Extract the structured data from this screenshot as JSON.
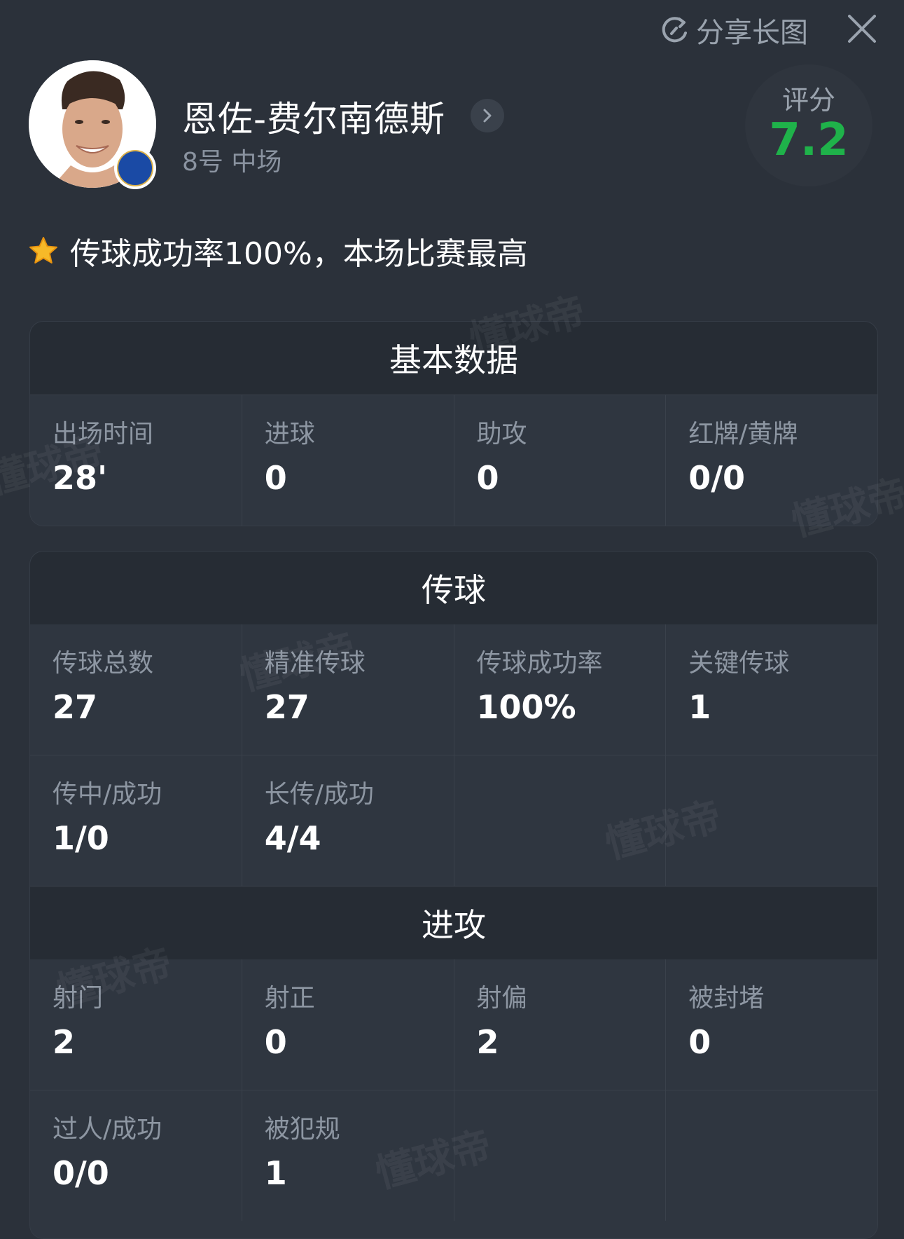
{
  "topbar": {
    "share_label": "分享长图"
  },
  "player": {
    "name": "恩佐-费尔南德斯",
    "number_position": "8号 中场",
    "rating_label": "评分",
    "rating_value": "7.2",
    "club_badge_text": "CHELSEA FOOTBALL CLUB"
  },
  "highlight": {
    "text": "传球成功率100%，本场比赛最高"
  },
  "watermark": "懂球帝",
  "basic": {
    "title": "基本数据",
    "rows": [
      [
        {
          "label": "出场时间",
          "value": "28'"
        },
        {
          "label": "进球",
          "value": "0"
        },
        {
          "label": "助攻",
          "value": "0"
        },
        {
          "label": "红牌/黄牌",
          "value": "0/0"
        }
      ]
    ]
  },
  "passing": {
    "title": "传球",
    "rows": [
      [
        {
          "label": "传球总数",
          "value": "27"
        },
        {
          "label": "精准传球",
          "value": "27"
        },
        {
          "label": "传球成功率",
          "value": "100%"
        },
        {
          "label": "关键传球",
          "value": "1"
        }
      ],
      [
        {
          "label": "传中/成功",
          "value": "1/0"
        },
        {
          "label": "长传/成功",
          "value": "4/4"
        },
        {
          "label": "",
          "value": ""
        },
        {
          "label": "",
          "value": ""
        }
      ]
    ]
  },
  "attack": {
    "title": "进攻",
    "rows": [
      [
        {
          "label": "射门",
          "value": "2"
        },
        {
          "label": "射正",
          "value": "0"
        },
        {
          "label": "射偏",
          "value": "2"
        },
        {
          "label": "被封堵",
          "value": "0"
        }
      ],
      [
        {
          "label": "过人/成功",
          "value": "0/0"
        },
        {
          "label": "被犯规",
          "value": "1"
        },
        {
          "label": "",
          "value": ""
        },
        {
          "label": "",
          "value": ""
        }
      ]
    ]
  },
  "colors": {
    "background": "#2b313a",
    "card": "#2f3640",
    "card_header": "#262c34",
    "rating": "#1fb24a",
    "label": "#8d96a2"
  }
}
